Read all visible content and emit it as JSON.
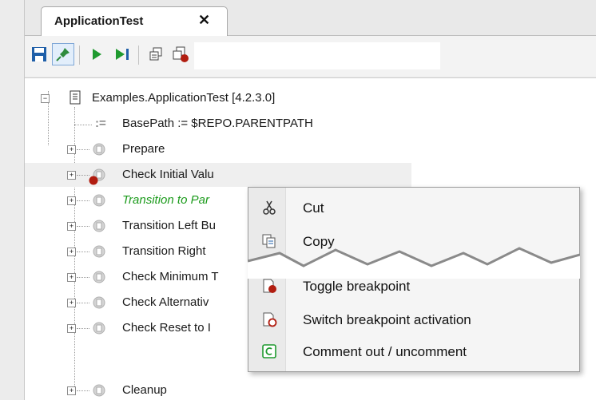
{
  "tab": {
    "title": "ApplicationTest",
    "close": "✕"
  },
  "toolbar": {
    "buttons": [
      "save-icon",
      "pin-icon",
      "run-icon",
      "step-icon",
      "breakpoint-window-icon",
      "breakpoint-stop-icon"
    ]
  },
  "tree": {
    "root": "Examples.ApplicationTest [4.2.3.0]",
    "items": [
      {
        "label": "BasePath := $REPO.PARENTPATH",
        "prefix": ":="
      },
      {
        "label": "Prepare"
      },
      {
        "label": "Check Initial Valu"
      },
      {
        "label": "Transition to Par"
      },
      {
        "label": "Transition Left Bu"
      },
      {
        "label": "Transition Right"
      },
      {
        "label": "Check Minimum T"
      },
      {
        "label": "Check Alternativ"
      },
      {
        "label": "Check Reset to I"
      },
      {
        "label": "Cleanup"
      }
    ]
  },
  "context_menu": {
    "items": [
      {
        "label": "Cut",
        "icon": "scissors-icon"
      },
      {
        "label": "Copy",
        "icon": "copy-icon"
      },
      {
        "label": "Toggle breakpoint",
        "icon": "toggle-breakpoint-icon"
      },
      {
        "label": "Switch breakpoint activation",
        "icon": "switch-breakpoint-icon"
      },
      {
        "label": "Comment out / uncomment",
        "icon": "comment-icon"
      }
    ]
  },
  "colors": {
    "accent_green": "#1a9a1a",
    "breakpoint_red": "#b11d10",
    "save_blue": "#1f5fa8"
  }
}
